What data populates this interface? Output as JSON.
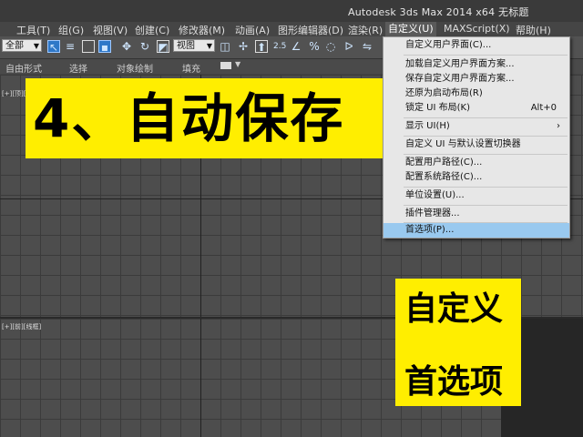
{
  "window": {
    "title": "Autodesk 3ds Max  2014 x64    无标题"
  },
  "menubar": {
    "items": [
      "工具(T)",
      "组(G)",
      "视图(V)",
      "创建(C)",
      "修改器(M)",
      "动画(A)",
      "图形编辑器(D)",
      "渲染(R)",
      "自定义(U)",
      "MAXScript(X)",
      "帮助(H)"
    ]
  },
  "toolbar": {
    "selection_filter": "全部",
    "reference_coord": "视图",
    "snap_label": "2.5",
    "percent_snap": "%"
  },
  "ribbon": {
    "tabs": [
      "自由形式",
      "选择",
      "对象绘制",
      "填充"
    ]
  },
  "viewports": {
    "top_label": "[+][顶][线框]",
    "bottom_label": "[+][前][线框]"
  },
  "overlay": {
    "banner": "4、自动保存",
    "callout_line1": "自定义",
    "callout_line2": "首选项"
  },
  "customize_menu": {
    "items": [
      {
        "label": "自定义用户界面(C)...",
        "shortcut": ""
      },
      {
        "label": "加载自定义用户界面方案...",
        "shortcut": ""
      },
      {
        "label": "保存自定义用户界面方案...",
        "shortcut": ""
      },
      {
        "label": "还原为启动布局(R)",
        "shortcut": ""
      },
      {
        "label": "锁定 UI 布局(K)",
        "shortcut": "Alt+0"
      },
      {
        "label": "显示 UI(H)",
        "shortcut": ""
      },
      {
        "label": "自定义 UI 与默认设置切换器",
        "shortcut": ""
      },
      {
        "label": "配置用户路径(C)...",
        "shortcut": ""
      },
      {
        "label": "配置系统路径(C)...",
        "shortcut": ""
      },
      {
        "label": "单位设置(U)...",
        "shortcut": ""
      },
      {
        "label": "插件管理器...",
        "shortcut": ""
      },
      {
        "label": "首选项(P)...",
        "shortcut": ""
      }
    ],
    "highlighted_index": 11
  },
  "colors": {
    "highlight_yellow": "#ffee00",
    "menu_highlight": "#99c9ef"
  }
}
